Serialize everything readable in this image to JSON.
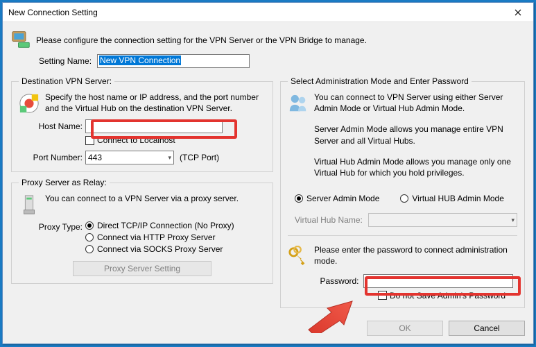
{
  "window": {
    "title": "New Connection Setting",
    "intro": "Please configure the connection setting for the VPN Server or the VPN Bridge to manage.",
    "setting_name_label": "Setting Name:",
    "setting_name_value": "New VPN Connection"
  },
  "dest": {
    "legend": "Destination VPN Server:",
    "desc": "Specify the host name or IP address, and the port number and the Virtual Hub on the destination VPN Server.",
    "host_label": "Host Name:",
    "host_value": "",
    "localhost_label": "Connect to Localhost",
    "port_label": "Port Number:",
    "port_value": "443",
    "port_note": "(TCP Port)"
  },
  "proxy": {
    "legend": "Proxy Server as Relay:",
    "desc": "You can connect to a VPN Server via a proxy server.",
    "type_label": "Proxy Type:",
    "opt_direct": "Direct TCP/IP Connection (No Proxy)",
    "opt_http": "Connect via HTTP Proxy Server",
    "opt_socks": "Connect via SOCKS Proxy Server",
    "button": "Proxy Server Setting"
  },
  "admin": {
    "legend": "Select Administration Mode and Enter Password",
    "desc1": "You can connect to VPN Server using either Server Admin Mode or Virtual Hub Admin Mode.",
    "desc2": "Server Admin Mode allows you manage entire VPN Server and all Virtual Hubs.",
    "desc3": "Virtual Hub Admin Mode allows you manage only one Virtual Hub for which you hold privileges.",
    "radio_server": "Server Admin Mode",
    "radio_vhub": "Virtual HUB Admin Mode",
    "vhub_label": "Virtual Hub Name:",
    "pwd_intro": "Please enter the password to connect administration mode.",
    "pwd_label": "Password:",
    "pwd_value": "",
    "nosave_label": "Do not Save Admin's Password"
  },
  "buttons": {
    "ok": "OK",
    "cancel": "Cancel"
  }
}
